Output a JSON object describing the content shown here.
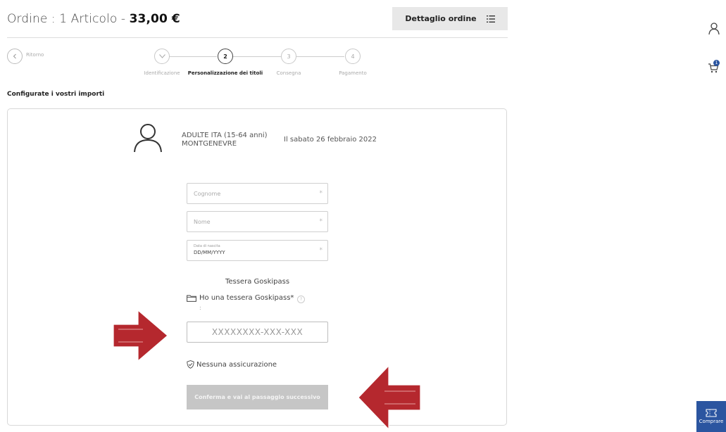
{
  "header": {
    "order_prefix": "Ordine : 1 Articolo - ",
    "order_price": "33,00 €",
    "detail_button": "Dettaglio ordine"
  },
  "nav": {
    "back_label": "Ritorno",
    "steps": [
      {
        "number": "",
        "label": "Identificazione",
        "state": "done"
      },
      {
        "number": "2",
        "label": "Personalizzazione dei titoli",
        "state": "active"
      },
      {
        "number": "3",
        "label": "Consegna",
        "state": "pending"
      },
      {
        "number": "4",
        "label": "Pagamento",
        "state": "pending"
      }
    ]
  },
  "section_title": "Configurate i vostri importi",
  "product": {
    "line1": "ADULTE ITA (15-64 anni)",
    "line2": "MONTGENEVRE",
    "date": "Il sabato 26 febbraio 2022"
  },
  "form": {
    "surname_placeholder": "Cognome",
    "name_placeholder": "Nome",
    "birth_label": "Data di nascita",
    "birth_placeholder": "DD/MM/YYYY",
    "required_mark": "*",
    "goskipass_title": "Tessera Goskipass",
    "goskipass_checkbox": "Ho una tessera Goskipass*",
    "help_mark": "?",
    "colon": ":",
    "card_placeholder": "XXXXXXXX-XXX-XXX",
    "insurance_label": "Nessuna assicurazione",
    "confirm_button": "Conferma e vai al passaggio successivo"
  },
  "sidebar": {
    "cart_count": "1",
    "buy_label": "Comprare"
  },
  "colors": {
    "arrow": "#b5282e",
    "buy_button": "#2b55a0",
    "disabled_button": "#c6c6c6"
  }
}
